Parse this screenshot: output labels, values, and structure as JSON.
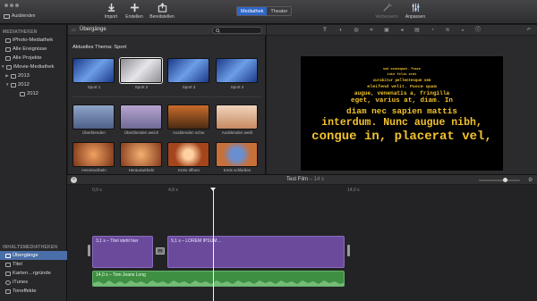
{
  "toolbar": {
    "ausblenden": "Ausblenden",
    "import": "Import",
    "erstellen": "Erstellen",
    "bereitstellen": "Bereitstellen",
    "mediathek": "Mediathek",
    "theater": "Theater",
    "verbessern": "Verbessern",
    "anpassen": "Anpassen"
  },
  "sidebar": {
    "mediatheken_heading": "MEDIATHEKEN",
    "items": [
      {
        "label": "iPhoto-Mediathek"
      },
      {
        "label": "Alle Ereignisse"
      },
      {
        "label": "Alle Projekte"
      },
      {
        "label": "iMovie-Mediathek"
      },
      {
        "label": "2013"
      },
      {
        "label": "2012"
      },
      {
        "label": "2012"
      }
    ],
    "inhalts_heading": "INHALTSMEDIATHEKEN",
    "content_items": [
      {
        "label": "Übergänge"
      },
      {
        "label": "Titel"
      },
      {
        "label": "Karten…rgründe"
      },
      {
        "label": "iTunes"
      },
      {
        "label": "Toneffekte"
      }
    ]
  },
  "browser": {
    "title": "Übergänge",
    "theme_heading": "Aktuelles Thema: Sport",
    "sport": [
      "Sport 1",
      "Sport 2",
      "Sport 3",
      "Sport 4"
    ],
    "transitions": [
      "Überblenden",
      "Überblenden weich",
      "Ausblenden schw.",
      "Ausblenden weiß",
      "Hereinwirbeln",
      "Herauswirbeln",
      "Kreis öffnen",
      "Kreis schließen"
    ]
  },
  "viewer": {
    "crawl_lines": [
      "sed consequat. Fusce",
      "inte felis erat",
      "curabitur pellentesque sem",
      "eleifend velit. Fusce quam",
      "augue, venenatis a, fringilla",
      "eget, varius at, diam. In",
      "diam nec sapien mattis",
      "interdum. Nunc augue nibh,",
      "congue in, placerat vel,"
    ]
  },
  "timeline": {
    "project": "Test Film",
    "duration": "14 s",
    "ruler": [
      "0,0 s",
      "4,8 s",
      "14,0 s"
    ],
    "clip_title": "3,1 s – Titel steht hier",
    "clip_lorem": "9,1 s – LOREM IPSUM…",
    "clip_audio": "14,0 s – Tom Jeans Long"
  }
}
